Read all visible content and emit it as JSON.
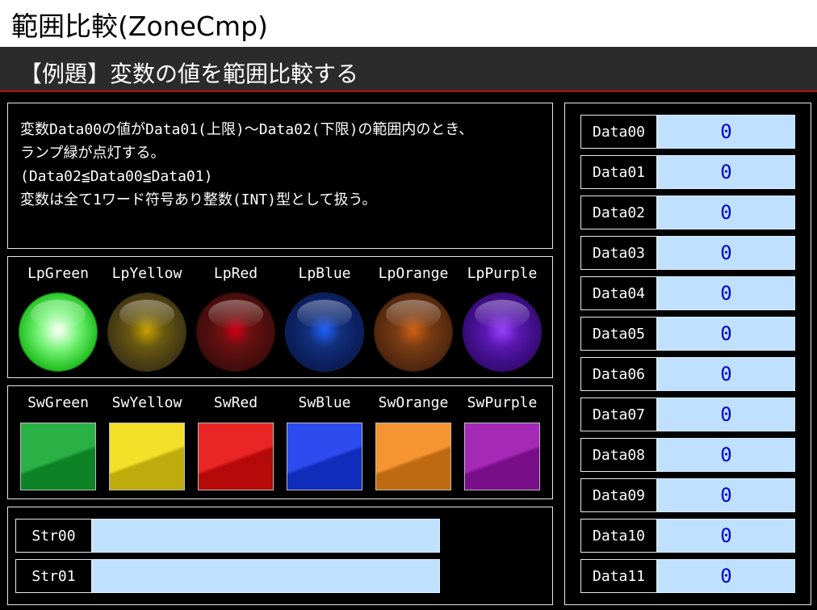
{
  "title": "範囲比較(ZoneCmp)",
  "subtitle": "【例題】変数の値を範囲比較する",
  "description": [
    "変数Data00の値がData01(上限)～Data02(下限)の範囲内のとき、",
    "ランプ緑が点灯する。",
    "(Data02≦Data00≦Data01)",
    "変数は全て1ワード符号あり整数(INT)型として扱う。"
  ],
  "lamps": [
    {
      "label": "LpGreen",
      "color": "#22dd22",
      "state": "on"
    },
    {
      "label": "LpYellow",
      "color": "#c8b400",
      "state": "off"
    },
    {
      "label": "LpRed",
      "color": "#cc1010",
      "state": "off"
    },
    {
      "label": "LpBlue",
      "color": "#1a3ccc",
      "state": "off"
    },
    {
      "label": "LpOrange",
      "color": "#d86818",
      "state": "off"
    },
    {
      "label": "LpPurple",
      "color": "#7a16c8",
      "state": "off"
    }
  ],
  "switches": [
    {
      "label": "SwGreen",
      "color": "#12a830"
    },
    {
      "label": "SwYellow",
      "color": "#f2dc10"
    },
    {
      "label": "SwRed",
      "color": "#e80c0c"
    },
    {
      "label": "SwBlue",
      "color": "#1438ee"
    },
    {
      "label": "SwOrange",
      "color": "#f48818"
    },
    {
      "label": "SwPurple",
      "color": "#9a12ae"
    }
  ],
  "strings": [
    {
      "label": "Str00",
      "value": ""
    },
    {
      "label": "Str01",
      "value": ""
    }
  ],
  "data": [
    {
      "label": "Data00",
      "value": "0"
    },
    {
      "label": "Data01",
      "value": "0"
    },
    {
      "label": "Data02",
      "value": "0"
    },
    {
      "label": "Data03",
      "value": "0"
    },
    {
      "label": "Data04",
      "value": "0"
    },
    {
      "label": "Data05",
      "value": "0"
    },
    {
      "label": "Data06",
      "value": "0"
    },
    {
      "label": "Data07",
      "value": "0"
    },
    {
      "label": "Data08",
      "value": "0"
    },
    {
      "label": "Data09",
      "value": "0"
    },
    {
      "label": "Data10",
      "value": "0"
    },
    {
      "label": "Data11",
      "value": "0"
    }
  ],
  "colors": {
    "field_bg": "#bfe0ff",
    "value_text": "#0000cc",
    "header_bg": "#2b2b2b",
    "header_rule": "#b01010"
  }
}
